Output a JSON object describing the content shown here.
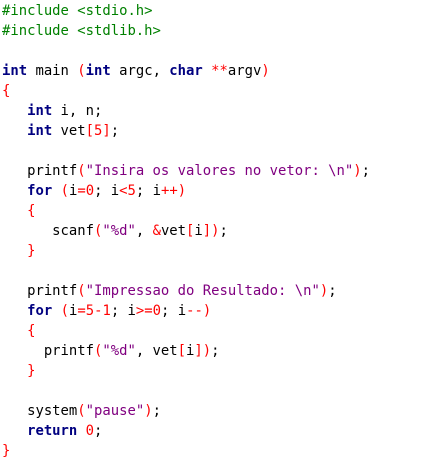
{
  "code": {
    "language": "c",
    "lines": [
      [
        {
          "t": "directive",
          "v": "#include <stdio.h>"
        }
      ],
      [
        {
          "t": "directive",
          "v": "#include <stdlib.h>"
        }
      ],
      [],
      [
        {
          "t": "keyword",
          "v": "int"
        },
        {
          "t": "plain",
          "v": " main "
        },
        {
          "t": "operator",
          "v": "("
        },
        {
          "t": "keyword",
          "v": "int"
        },
        {
          "t": "plain",
          "v": " argc, "
        },
        {
          "t": "keyword",
          "v": "char"
        },
        {
          "t": "plain",
          "v": " "
        },
        {
          "t": "operator",
          "v": "**"
        },
        {
          "t": "plain",
          "v": "argv"
        },
        {
          "t": "operator",
          "v": ")"
        }
      ],
      [
        {
          "t": "operator",
          "v": "{"
        }
      ],
      [
        {
          "t": "plain",
          "v": "   "
        },
        {
          "t": "keyword",
          "v": "int"
        },
        {
          "t": "plain",
          "v": " i, n;"
        }
      ],
      [
        {
          "t": "plain",
          "v": "   "
        },
        {
          "t": "keyword",
          "v": "int"
        },
        {
          "t": "plain",
          "v": " vet"
        },
        {
          "t": "operator",
          "v": "["
        },
        {
          "t": "number",
          "v": "5"
        },
        {
          "t": "operator",
          "v": "]"
        },
        {
          "t": "plain",
          "v": ";"
        }
      ],
      [],
      [
        {
          "t": "plain",
          "v": "   printf"
        },
        {
          "t": "operator",
          "v": "("
        },
        {
          "t": "string",
          "v": "\"Insira os valores no vetor: \\n\""
        },
        {
          "t": "operator",
          "v": ")"
        },
        {
          "t": "plain",
          "v": ";"
        }
      ],
      [
        {
          "t": "plain",
          "v": "   "
        },
        {
          "t": "keyword",
          "v": "for"
        },
        {
          "t": "plain",
          "v": " "
        },
        {
          "t": "operator",
          "v": "("
        },
        {
          "t": "plain",
          "v": "i"
        },
        {
          "t": "operator",
          "v": "="
        },
        {
          "t": "number",
          "v": "0"
        },
        {
          "t": "plain",
          "v": "; i"
        },
        {
          "t": "operator",
          "v": "<"
        },
        {
          "t": "number",
          "v": "5"
        },
        {
          "t": "plain",
          "v": "; i"
        },
        {
          "t": "operator",
          "v": "++)"
        }
      ],
      [
        {
          "t": "plain",
          "v": "   "
        },
        {
          "t": "operator",
          "v": "{"
        }
      ],
      [
        {
          "t": "plain",
          "v": "      scanf"
        },
        {
          "t": "operator",
          "v": "("
        },
        {
          "t": "string",
          "v": "\"%d\""
        },
        {
          "t": "plain",
          "v": ", "
        },
        {
          "t": "operator",
          "v": "&"
        },
        {
          "t": "plain",
          "v": "vet"
        },
        {
          "t": "operator",
          "v": "["
        },
        {
          "t": "plain",
          "v": "i"
        },
        {
          "t": "operator",
          "v": "])"
        },
        {
          "t": "plain",
          "v": ";"
        }
      ],
      [
        {
          "t": "plain",
          "v": "   "
        },
        {
          "t": "operator",
          "v": "}"
        }
      ],
      [],
      [
        {
          "t": "plain",
          "v": "   printf"
        },
        {
          "t": "operator",
          "v": "("
        },
        {
          "t": "string",
          "v": "\"Impressao do Resultado: \\n\""
        },
        {
          "t": "operator",
          "v": ")"
        },
        {
          "t": "plain",
          "v": ";"
        }
      ],
      [
        {
          "t": "plain",
          "v": "   "
        },
        {
          "t": "keyword",
          "v": "for"
        },
        {
          "t": "plain",
          "v": " "
        },
        {
          "t": "operator",
          "v": "("
        },
        {
          "t": "plain",
          "v": "i"
        },
        {
          "t": "operator",
          "v": "="
        },
        {
          "t": "number",
          "v": "5"
        },
        {
          "t": "operator",
          "v": "-"
        },
        {
          "t": "number",
          "v": "1"
        },
        {
          "t": "plain",
          "v": "; i"
        },
        {
          "t": "operator",
          "v": ">="
        },
        {
          "t": "number",
          "v": "0"
        },
        {
          "t": "plain",
          "v": "; i"
        },
        {
          "t": "operator",
          "v": "--)"
        }
      ],
      [
        {
          "t": "plain",
          "v": "   "
        },
        {
          "t": "operator",
          "v": "{"
        }
      ],
      [
        {
          "t": "plain",
          "v": "     printf"
        },
        {
          "t": "operator",
          "v": "("
        },
        {
          "t": "string",
          "v": "\"%d\""
        },
        {
          "t": "plain",
          "v": ", vet"
        },
        {
          "t": "operator",
          "v": "["
        },
        {
          "t": "plain",
          "v": "i"
        },
        {
          "t": "operator",
          "v": "])"
        },
        {
          "t": "plain",
          "v": ";"
        }
      ],
      [
        {
          "t": "plain",
          "v": "   "
        },
        {
          "t": "operator",
          "v": "}"
        }
      ],
      [],
      [
        {
          "t": "plain",
          "v": "   system"
        },
        {
          "t": "operator",
          "v": "("
        },
        {
          "t": "string",
          "v": "\"pause\""
        },
        {
          "t": "operator",
          "v": ")"
        },
        {
          "t": "plain",
          "v": ";"
        }
      ],
      [
        {
          "t": "plain",
          "v": "   "
        },
        {
          "t": "keyword",
          "v": "return"
        },
        {
          "t": "plain",
          "v": " "
        },
        {
          "t": "number",
          "v": "0"
        },
        {
          "t": "plain",
          "v": ";"
        }
      ],
      [
        {
          "t": "operator",
          "v": "}"
        }
      ]
    ]
  },
  "colors": {
    "background": "#ffffff",
    "directive": "#008000",
    "keyword": "#000080",
    "string": "#800080",
    "number": "#ff0000",
    "operator": "#ff0000",
    "plain": "#000000"
  }
}
